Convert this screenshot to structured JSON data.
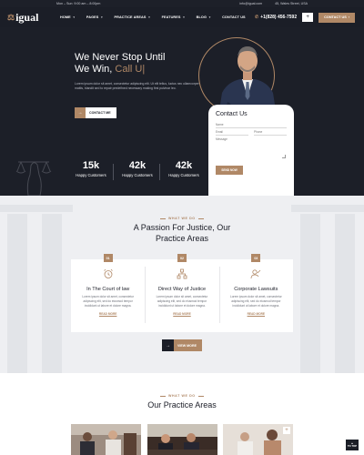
{
  "topbar": {
    "hours": "Mon – Sun: 9:00 am – 8:00pm",
    "email": "info@igual.com",
    "address": "45, Wales Street, USA"
  },
  "header": {
    "logo": "igual",
    "nav": [
      "HOME",
      "PAGES",
      "PRACTICE AREAS",
      "FEATURES",
      "BLOG",
      "CONTACT US"
    ],
    "phone": "+1(828) 456-7592",
    "cta_label": "CONTACT US"
  },
  "hero": {
    "title_line1": "We Never Stop Until",
    "title_line2_prefix": "We Win,",
    "title_accent": "Call U|",
    "text": "Lorem ipsum dolor sit amet, consectetur adipiscing elit. Ut elit tellus, luctus nec ullamcorper mattis, blandit sed to repair predefined necessary making first pulvinar leo.",
    "button_label": "CONTACT ME"
  },
  "contact_form": {
    "title": "Contact Us",
    "name_placeholder": "Name",
    "email_placeholder": "Email",
    "phone_placeholder": "Phone",
    "message_placeholder": "Message",
    "submit_label": "SEND NOW"
  },
  "stats": [
    {
      "value": "15k",
      "label": "Happy Customers"
    },
    {
      "value": "42k",
      "label": "Happy Customers"
    },
    {
      "value": "42k",
      "label": "Happy Customers"
    }
  ],
  "practice": {
    "kicker": "WHAT WE DO",
    "title_line1": "A Passion For Justice, Our",
    "title_line2": "Practice Areas",
    "cards": [
      {
        "num": "01",
        "icon": "alarm-clock-icon",
        "title": "In The Court of law",
        "text": "Lorem ipsum dolor sit amet, consectetur adipiscing elit, sed do eiusmod tempor incididunt ut labore et dolore magna.",
        "link": "READ MORE"
      },
      {
        "num": "02",
        "icon": "network-icon",
        "title": "Direct Way of Justice",
        "text": "Lorem ipsum dolor sit amet, consectetur adipiscing elit, sed do eiusmod tempor incididunt ut labore et dolore magna.",
        "link": "READ MORE"
      },
      {
        "num": "03",
        "icon": "person-icon",
        "title": "Corporate Lawsuits",
        "text": "Lorem ipsum dolor sit amet, consectetur adipiscing elit, sed do eiusmod tempor incididunt ut labore et dolore magna.",
        "link": "READ MORE"
      }
    ],
    "view_more_label": "VIEW MORE"
  },
  "areas": {
    "kicker": "WHAT WE DO",
    "title": "Our Practice Areas"
  },
  "scroll_top_label": "TO TOP",
  "colors": {
    "accent": "#b08866",
    "dark": "#1c1f28"
  }
}
